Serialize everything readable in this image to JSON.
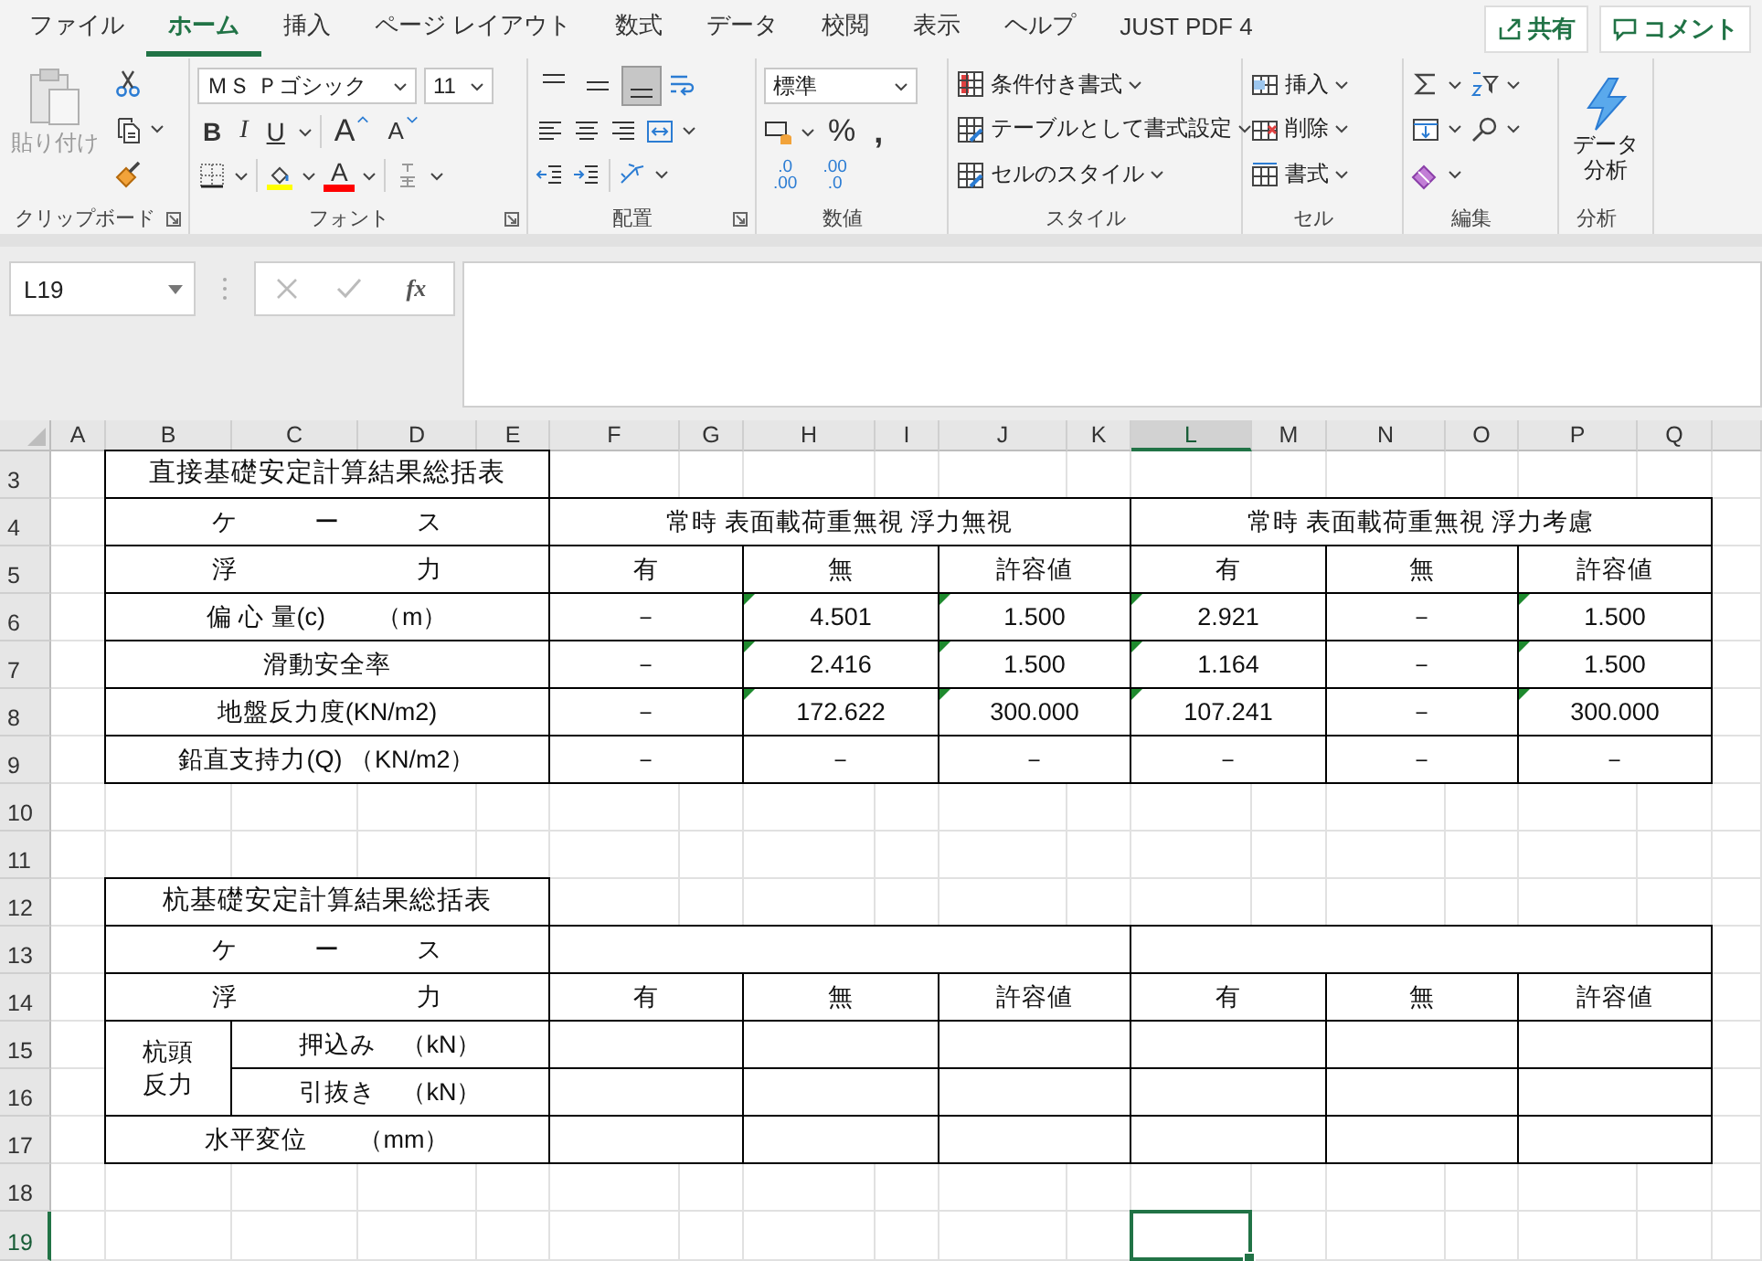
{
  "tabs": [
    {
      "label": "ファイル",
      "selected": false
    },
    {
      "label": "ホーム",
      "selected": true
    },
    {
      "label": "挿入",
      "selected": false
    },
    {
      "label": "ページ レイアウト",
      "selected": false
    },
    {
      "label": "数式",
      "selected": false
    },
    {
      "label": "データ",
      "selected": false
    },
    {
      "label": "校閲",
      "selected": false
    },
    {
      "label": "表示",
      "selected": false
    },
    {
      "label": "ヘルプ",
      "selected": false
    },
    {
      "label": "JUST PDF 4",
      "selected": false
    }
  ],
  "share_button": "共有",
  "comment_button": "コメント",
  "ribbon": {
    "clipboard": {
      "label": "クリップボード",
      "paste": "貼り付け",
      "paste_disabled": true
    },
    "font": {
      "label": "フォント",
      "name": "ＭＳ Ｐゴシック",
      "size": "11",
      "bold": "B",
      "italic": "I",
      "underline": "U",
      "grow": "A",
      "shrink": "A",
      "color_letter": "A"
    },
    "alignment": {
      "label": "配置",
      "vertical": [
        {
          "selected": false
        },
        {
          "selected": false
        },
        {
          "selected": true
        }
      ]
    },
    "number": {
      "label": "数値",
      "format": "標準",
      "percent": "%",
      "comma": ",",
      "decimals": [
        [
          ".0",
          ".00"
        ],
        [
          ".00",
          ".0"
        ]
      ]
    },
    "styles": {
      "label": "スタイル",
      "items": [
        "条件付き書式",
        "テーブルとして書式設定",
        "セルのスタイル"
      ]
    },
    "cells": {
      "label": "セル",
      "items": [
        "挿入",
        "削除",
        "書式"
      ]
    },
    "editing": {
      "label": "編集"
    },
    "analysis": {
      "label": "分析",
      "button": [
        "データ",
        "分析"
      ]
    }
  },
  "formula_bar": {
    "name_box": "L19",
    "function_label": "fx"
  },
  "sheet": {
    "columns": [
      {
        "label": "A",
        "selected": false
      },
      {
        "label": "B",
        "selected": false
      },
      {
        "label": "C",
        "selected": false
      },
      {
        "label": "D",
        "selected": false
      },
      {
        "label": "E",
        "selected": false
      },
      {
        "label": "F",
        "selected": false
      },
      {
        "label": "G",
        "selected": false
      },
      {
        "label": "H",
        "selected": false
      },
      {
        "label": "I",
        "selected": false
      },
      {
        "label": "J",
        "selected": false
      },
      {
        "label": "K",
        "selected": false
      },
      {
        "label": "L",
        "selected": true
      },
      {
        "label": "M",
        "selected": false
      },
      {
        "label": "N",
        "selected": false
      },
      {
        "label": "O",
        "selected": false
      },
      {
        "label": "P",
        "selected": false
      },
      {
        "label": "Q",
        "selected": false
      }
    ],
    "rows": [
      {
        "label": "3",
        "selected": false
      },
      {
        "label": "4",
        "selected": false
      },
      {
        "label": "5",
        "selected": false
      },
      {
        "label": "6",
        "selected": false
      },
      {
        "label": "7",
        "selected": false
      },
      {
        "label": "8",
        "selected": false
      },
      {
        "label": "9",
        "selected": false
      },
      {
        "label": "10",
        "selected": false
      },
      {
        "label": "11",
        "selected": false
      },
      {
        "label": "12",
        "selected": false
      },
      {
        "label": "13",
        "selected": false
      },
      {
        "label": "14",
        "selected": false
      },
      {
        "label": "15",
        "selected": false
      },
      {
        "label": "16",
        "selected": false
      },
      {
        "label": "17",
        "selected": false
      },
      {
        "label": "18",
        "selected": false
      },
      {
        "label": "19",
        "selected": true
      }
    ]
  },
  "foundation_table": {
    "title": "直接基礎安定計算結果総括表",
    "case_label": "ケ　　　ー　　　ス",
    "cases": [
      "常時 表面載荷重無視 浮力無視",
      "常時 表面載荷重無視 浮力考慮"
    ],
    "buoyancy_label": "浮　　　　　　　力",
    "subheads": [
      "有",
      "無",
      "許容値",
      "有",
      "無",
      "許容値"
    ],
    "rows": [
      {
        "label": "偏 心 量(c)　　（m）",
        "values": [
          {
            "text": "－",
            "flag": false
          },
          {
            "text": "4.501",
            "flag": true
          },
          {
            "text": "1.500",
            "flag": true
          },
          {
            "text": "2.921",
            "flag": true
          },
          {
            "text": "－",
            "flag": false
          },
          {
            "text": "1.500",
            "flag": true
          }
        ]
      },
      {
        "label": "滑動安全率",
        "values": [
          {
            "text": "－",
            "flag": false
          },
          {
            "text": "2.416",
            "flag": true
          },
          {
            "text": "1.500",
            "flag": true
          },
          {
            "text": "1.164",
            "flag": true
          },
          {
            "text": "－",
            "flag": false
          },
          {
            "text": "1.500",
            "flag": true
          }
        ]
      },
      {
        "label": "地盤反力度(KN/m2)",
        "values": [
          {
            "text": "－",
            "flag": false
          },
          {
            "text": "172.622",
            "flag": true
          },
          {
            "text": "300.000",
            "flag": true
          },
          {
            "text": "107.241",
            "flag": true
          },
          {
            "text": "－",
            "flag": false
          },
          {
            "text": "300.000",
            "flag": true
          }
        ]
      },
      {
        "label": "鉛直支持力(Q) （KN/m2）",
        "values": [
          {
            "text": "－",
            "flag": false
          },
          {
            "text": "－",
            "flag": false
          },
          {
            "text": "－",
            "flag": false
          },
          {
            "text": "－",
            "flag": false
          },
          {
            "text": "－",
            "flag": false
          },
          {
            "text": "－",
            "flag": false
          }
        ]
      }
    ]
  },
  "pile_table": {
    "title": "杭基礎安定計算結果総括表",
    "case_label": "ケ　　　ー　　　ス",
    "buoyancy_label": "浮　　　　　　　力",
    "subheads": [
      "有",
      "無",
      "許容値",
      "有",
      "無",
      "許容値"
    ],
    "rows": [
      {
        "label": [
          "杭頭",
          "反力"
        ],
        "children": [
          {
            "label": "押込み　（kN）"
          },
          {
            "label": "引抜き　（kN）"
          }
        ]
      },
      {
        "label": "水平変位　　（mm）"
      }
    ]
  }
}
